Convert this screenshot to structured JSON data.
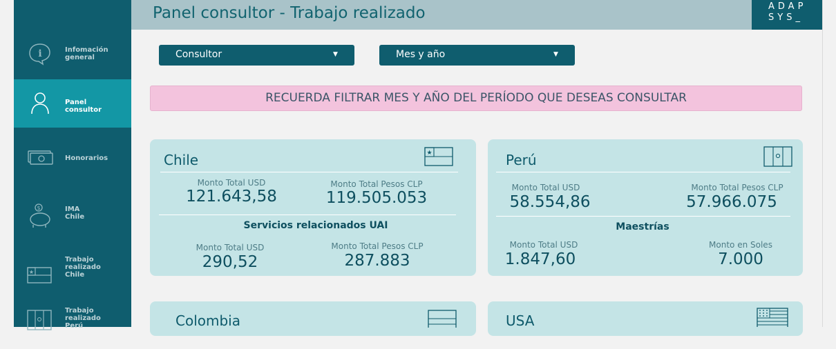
{
  "header": {
    "title": "Panel consultor - Trabajo realizado",
    "logo_line1": "ADAP",
    "logo_line2": "SYS_"
  },
  "sidebar": {
    "items": [
      {
        "label_line1": "Infomación",
        "label_line2": "general",
        "label_line3": ""
      },
      {
        "label_line1": "Panel",
        "label_line2": "consultor",
        "label_line3": ""
      },
      {
        "label_line1": "Honorarios",
        "label_line2": "",
        "label_line3": ""
      },
      {
        "label_line1": "IMA",
        "label_line2": "Chile",
        "label_line3": ""
      },
      {
        "label_line1": "Trabajo",
        "label_line2": "realizado",
        "label_line3": "Chile"
      },
      {
        "label_line1": "Trabajo",
        "label_line2": "realizado",
        "label_line3": "Perú"
      }
    ]
  },
  "filters": {
    "consultor": "Consultor",
    "mes_anio": "Mes y año"
  },
  "banner": "RECUERDA FILTRAR MES Y AÑO DEL PERÍODO QUE DESEAS CONSULTAR",
  "cards": {
    "chile": {
      "title": "Chile",
      "usd_label": "Monto Total USD",
      "usd_value": "121.643,58",
      "clp_label": "Monto Total Pesos CLP",
      "clp_value": "119.505.053",
      "section": "Servicios relacionados UAI",
      "usd2_label": "Monto Total USD",
      "usd2_value": "290,52",
      "clp2_label": "Monto Total Pesos CLP",
      "clp2_value": "287.883"
    },
    "peru": {
      "title": "Perú",
      "usd_label": "Monto Total USD",
      "usd_value": "58.554,86",
      "clp_label": "Monto Total Pesos CLP",
      "clp_value": "57.966.075",
      "section": "Maestrías",
      "usd2_label": "Monto Total USD",
      "usd2_value": "1.847,60",
      "soles_label": "Monto en Soles",
      "soles_value": "7.000"
    },
    "colombia": {
      "title": "Colombia"
    },
    "usa": {
      "title": "USA"
    }
  },
  "colors": {
    "sidebar": "#0f5d6e",
    "active": "#1397a5",
    "card": "#c4e4e6",
    "banner": "#f3c3dd"
  }
}
